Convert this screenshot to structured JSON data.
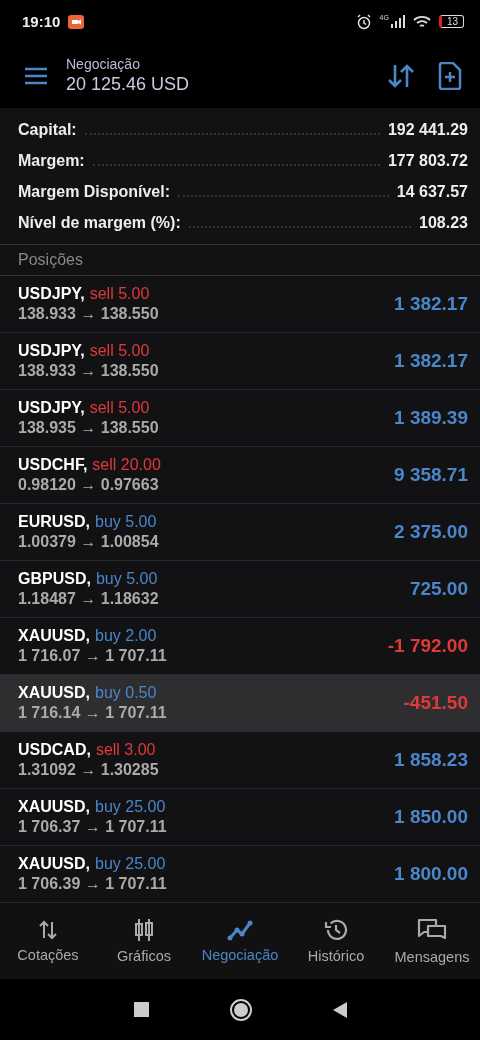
{
  "status_bar": {
    "time": "19:10",
    "network": "4G",
    "battery": "13"
  },
  "header": {
    "title": "Negociação",
    "balance": "20 125.46 USD"
  },
  "summary": [
    {
      "label": "Capital:",
      "value": "192 441.29"
    },
    {
      "label": "Margem:",
      "value": "177 803.72"
    },
    {
      "label": "Margem Disponível:",
      "value": "14 637.57"
    },
    {
      "label": "Nível de margem (%):",
      "value": "108.23"
    }
  ],
  "positions_header": "Posições",
  "positions": [
    {
      "symbol": "USDJPY,",
      "kind": "sell",
      "order": "sell 5.00",
      "prices": "138.933 → 138.550",
      "profit": "1 382.17",
      "negative": false,
      "selected": false
    },
    {
      "symbol": "USDJPY,",
      "kind": "sell",
      "order": "sell 5.00",
      "prices": "138.933 → 138.550",
      "profit": "1 382.17",
      "negative": false,
      "selected": false
    },
    {
      "symbol": "USDJPY,",
      "kind": "sell",
      "order": "sell 5.00",
      "prices": "138.935 → 138.550",
      "profit": "1 389.39",
      "negative": false,
      "selected": false
    },
    {
      "symbol": "USDCHF,",
      "kind": "sell",
      "order": "sell 20.00",
      "prices": "0.98120 → 0.97663",
      "profit": "9 358.71",
      "negative": false,
      "selected": false
    },
    {
      "symbol": "EURUSD,",
      "kind": "buy",
      "order": "buy 5.00",
      "prices": "1.00379 → 1.00854",
      "profit": "2 375.00",
      "negative": false,
      "selected": false
    },
    {
      "symbol": "GBPUSD,",
      "kind": "buy",
      "order": "buy 5.00",
      "prices": "1.18487 → 1.18632",
      "profit": "725.00",
      "negative": false,
      "selected": false
    },
    {
      "symbol": "XAUUSD,",
      "kind": "buy",
      "order": "buy 2.00",
      "prices": "1 716.07 → 1 707.11",
      "profit": "-1 792.00",
      "negative": true,
      "selected": false
    },
    {
      "symbol": "XAUUSD,",
      "kind": "buy",
      "order": "buy 0.50",
      "prices": "1 716.14 → 1 707.11",
      "profit": "-451.50",
      "negative": true,
      "selected": true
    },
    {
      "symbol": "USDCAD,",
      "kind": "sell",
      "order": "sell 3.00",
      "prices": "1.31092 → 1.30285",
      "profit": "1 858.23",
      "negative": false,
      "selected": false
    },
    {
      "symbol": "XAUUSD,",
      "kind": "buy",
      "order": "buy 25.00",
      "prices": "1 706.37 → 1 707.11",
      "profit": "1 850.00",
      "negative": false,
      "selected": false
    },
    {
      "symbol": "XAUUSD,",
      "kind": "buy",
      "order": "buy 25.00",
      "prices": "1 706.39 → 1 707.11",
      "profit": "1 800.00",
      "negative": false,
      "selected": false
    }
  ],
  "bottom_nav": [
    {
      "kind": "quotes",
      "label": "Cotações",
      "selected": false
    },
    {
      "kind": "charts",
      "label": "Gráficos",
      "selected": false
    },
    {
      "kind": "trade",
      "label": "Negociação",
      "selected": true
    },
    {
      "kind": "history",
      "label": "Histórico",
      "selected": false
    },
    {
      "kind": "messages",
      "label": "Mensagens",
      "selected": false
    }
  ]
}
